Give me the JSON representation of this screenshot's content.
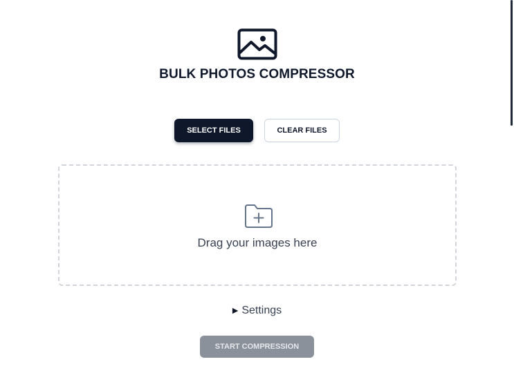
{
  "app": {
    "title": "BULK PHOTOS COMPRESSOR",
    "logo_icon": "image-icon"
  },
  "toolbar": {
    "select_files_label": "SELECT FILES",
    "clear_files_label": "CLEAR FILES"
  },
  "dropzone": {
    "icon": "folder-plus-icon",
    "text": "Drag your images here"
  },
  "settings": {
    "toggle_icon": "triangle-right-icon",
    "label": "Settings"
  },
  "actions": {
    "start_label": "START COMPRESSION",
    "start_disabled": true
  },
  "colors": {
    "primary": "#0f172a",
    "border": "#cbd5e1",
    "dashed_border": "#d1d5db",
    "disabled_button": "#8b919b"
  }
}
